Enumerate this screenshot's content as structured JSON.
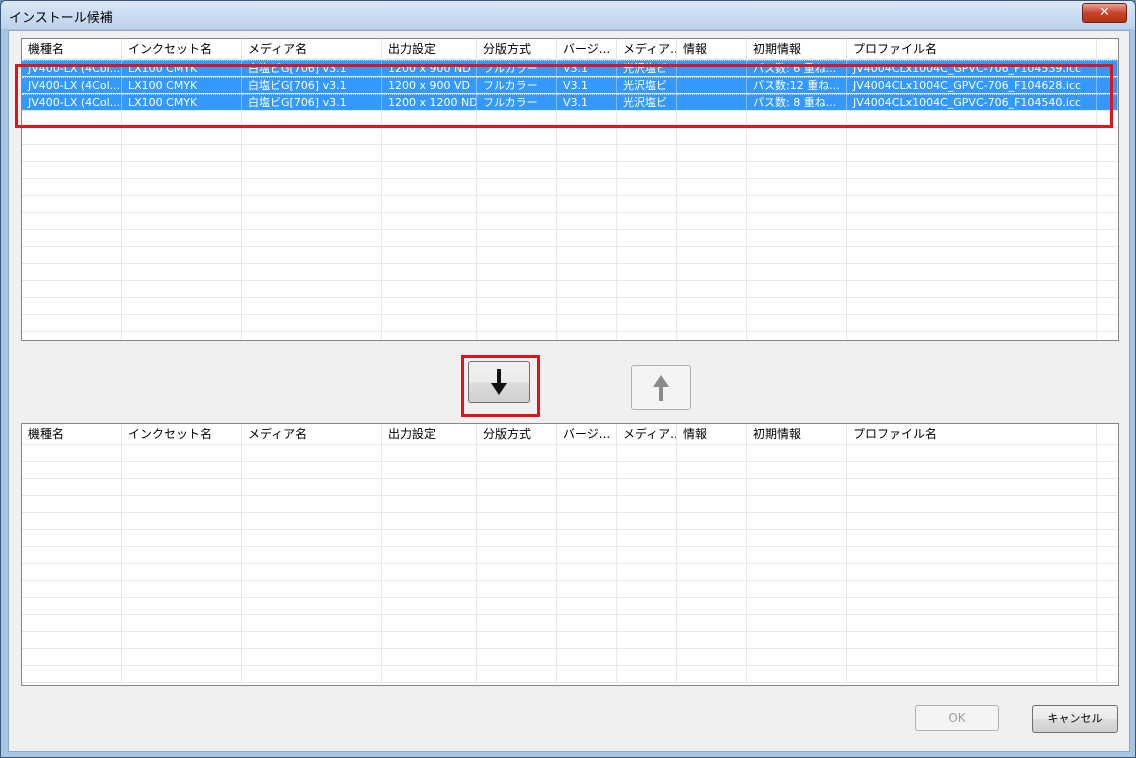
{
  "window": {
    "title": "インストール候補",
    "close_label": "✕"
  },
  "columns": [
    "機種名",
    "インクセット名",
    "メディア名",
    "出力設定",
    "分版方式",
    "バージ...",
    "メディア...",
    "情報",
    "初期情報",
    "プロファイル名"
  ],
  "top_rows": [
    [
      "JV400-LX (4Col...",
      "LX100 CMYK",
      "白塩ビG[706] v3.1",
      "1200 x 900 ND",
      "フルカラー",
      "V3.1",
      "光沢塩ビ",
      "",
      "パス数: 6  重ね...",
      "JV4004CLx1004C_GPVC-706_F104539.icc"
    ],
    [
      "JV400-LX (4Col...",
      "LX100 CMYK",
      "白塩ビG[706] v3.1",
      "1200 x 900 VD",
      "フルカラー",
      "V3.1",
      "光沢塩ビ",
      "",
      "パス数:12  重ね...",
      "JV4004CLx1004C_GPVC-706_F104628.icc"
    ],
    [
      "JV400-LX (4Col...",
      "LX100 CMYK",
      "白塩ビG[706] v3.1",
      "1200 x 1200 ND",
      "フルカラー",
      "V3.1",
      "光沢塩ビ",
      "",
      "パス数: 8  重ね...",
      "JV4004CLx1004C_GPVC-706_F104540.icc"
    ]
  ],
  "buttons": {
    "ok_label": "OK",
    "cancel_label": "キャンセル",
    "move_down_icon": "arrow-down-icon",
    "move_up_icon": "arrow-up-icon"
  },
  "colors": {
    "selection": "#3399ff",
    "highlight_border": "#e0141b"
  }
}
